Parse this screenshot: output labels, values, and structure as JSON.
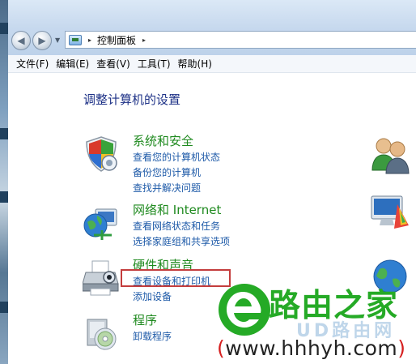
{
  "address": {
    "crumb": "控制面板",
    "separator": "▸"
  },
  "menu": [
    "文件(F)",
    "编辑(E)",
    "查看(V)",
    "工具(T)",
    "帮助(H)"
  ],
  "page_title": "调整计算机的设置",
  "categories": [
    {
      "title": "系统和安全",
      "icon": "shield-icon",
      "links": [
        "查看您的计算机状态",
        "备份您的计算机",
        "查找并解决问题"
      ]
    },
    {
      "title": "网络和 Internet",
      "icon": "network-globe-icon",
      "links": [
        "查看网络状态和任务",
        "选择家庭组和共享选项"
      ]
    },
    {
      "title": "硬件和声音",
      "icon": "printer-icon",
      "links": [
        "查看设备和打印机",
        "添加设备"
      ]
    },
    {
      "title": "程序",
      "icon": "programs-disc-icon",
      "links": [
        "卸载程序"
      ]
    }
  ],
  "right_icons": [
    "user-accounts-icon",
    "appearance-icon",
    "globe-icon"
  ],
  "watermark": {
    "brand": "路由之家",
    "ghost": "UD路由网",
    "url_open": "(",
    "url": "www.hhhyh.com",
    "url_close": ")"
  },
  "colors": {
    "category_title": "#1f8a1f",
    "link": "#1e5aa8",
    "page_title": "#1e3287",
    "highlight_box": "#c43d3d",
    "watermark_green": "#25aa26"
  }
}
